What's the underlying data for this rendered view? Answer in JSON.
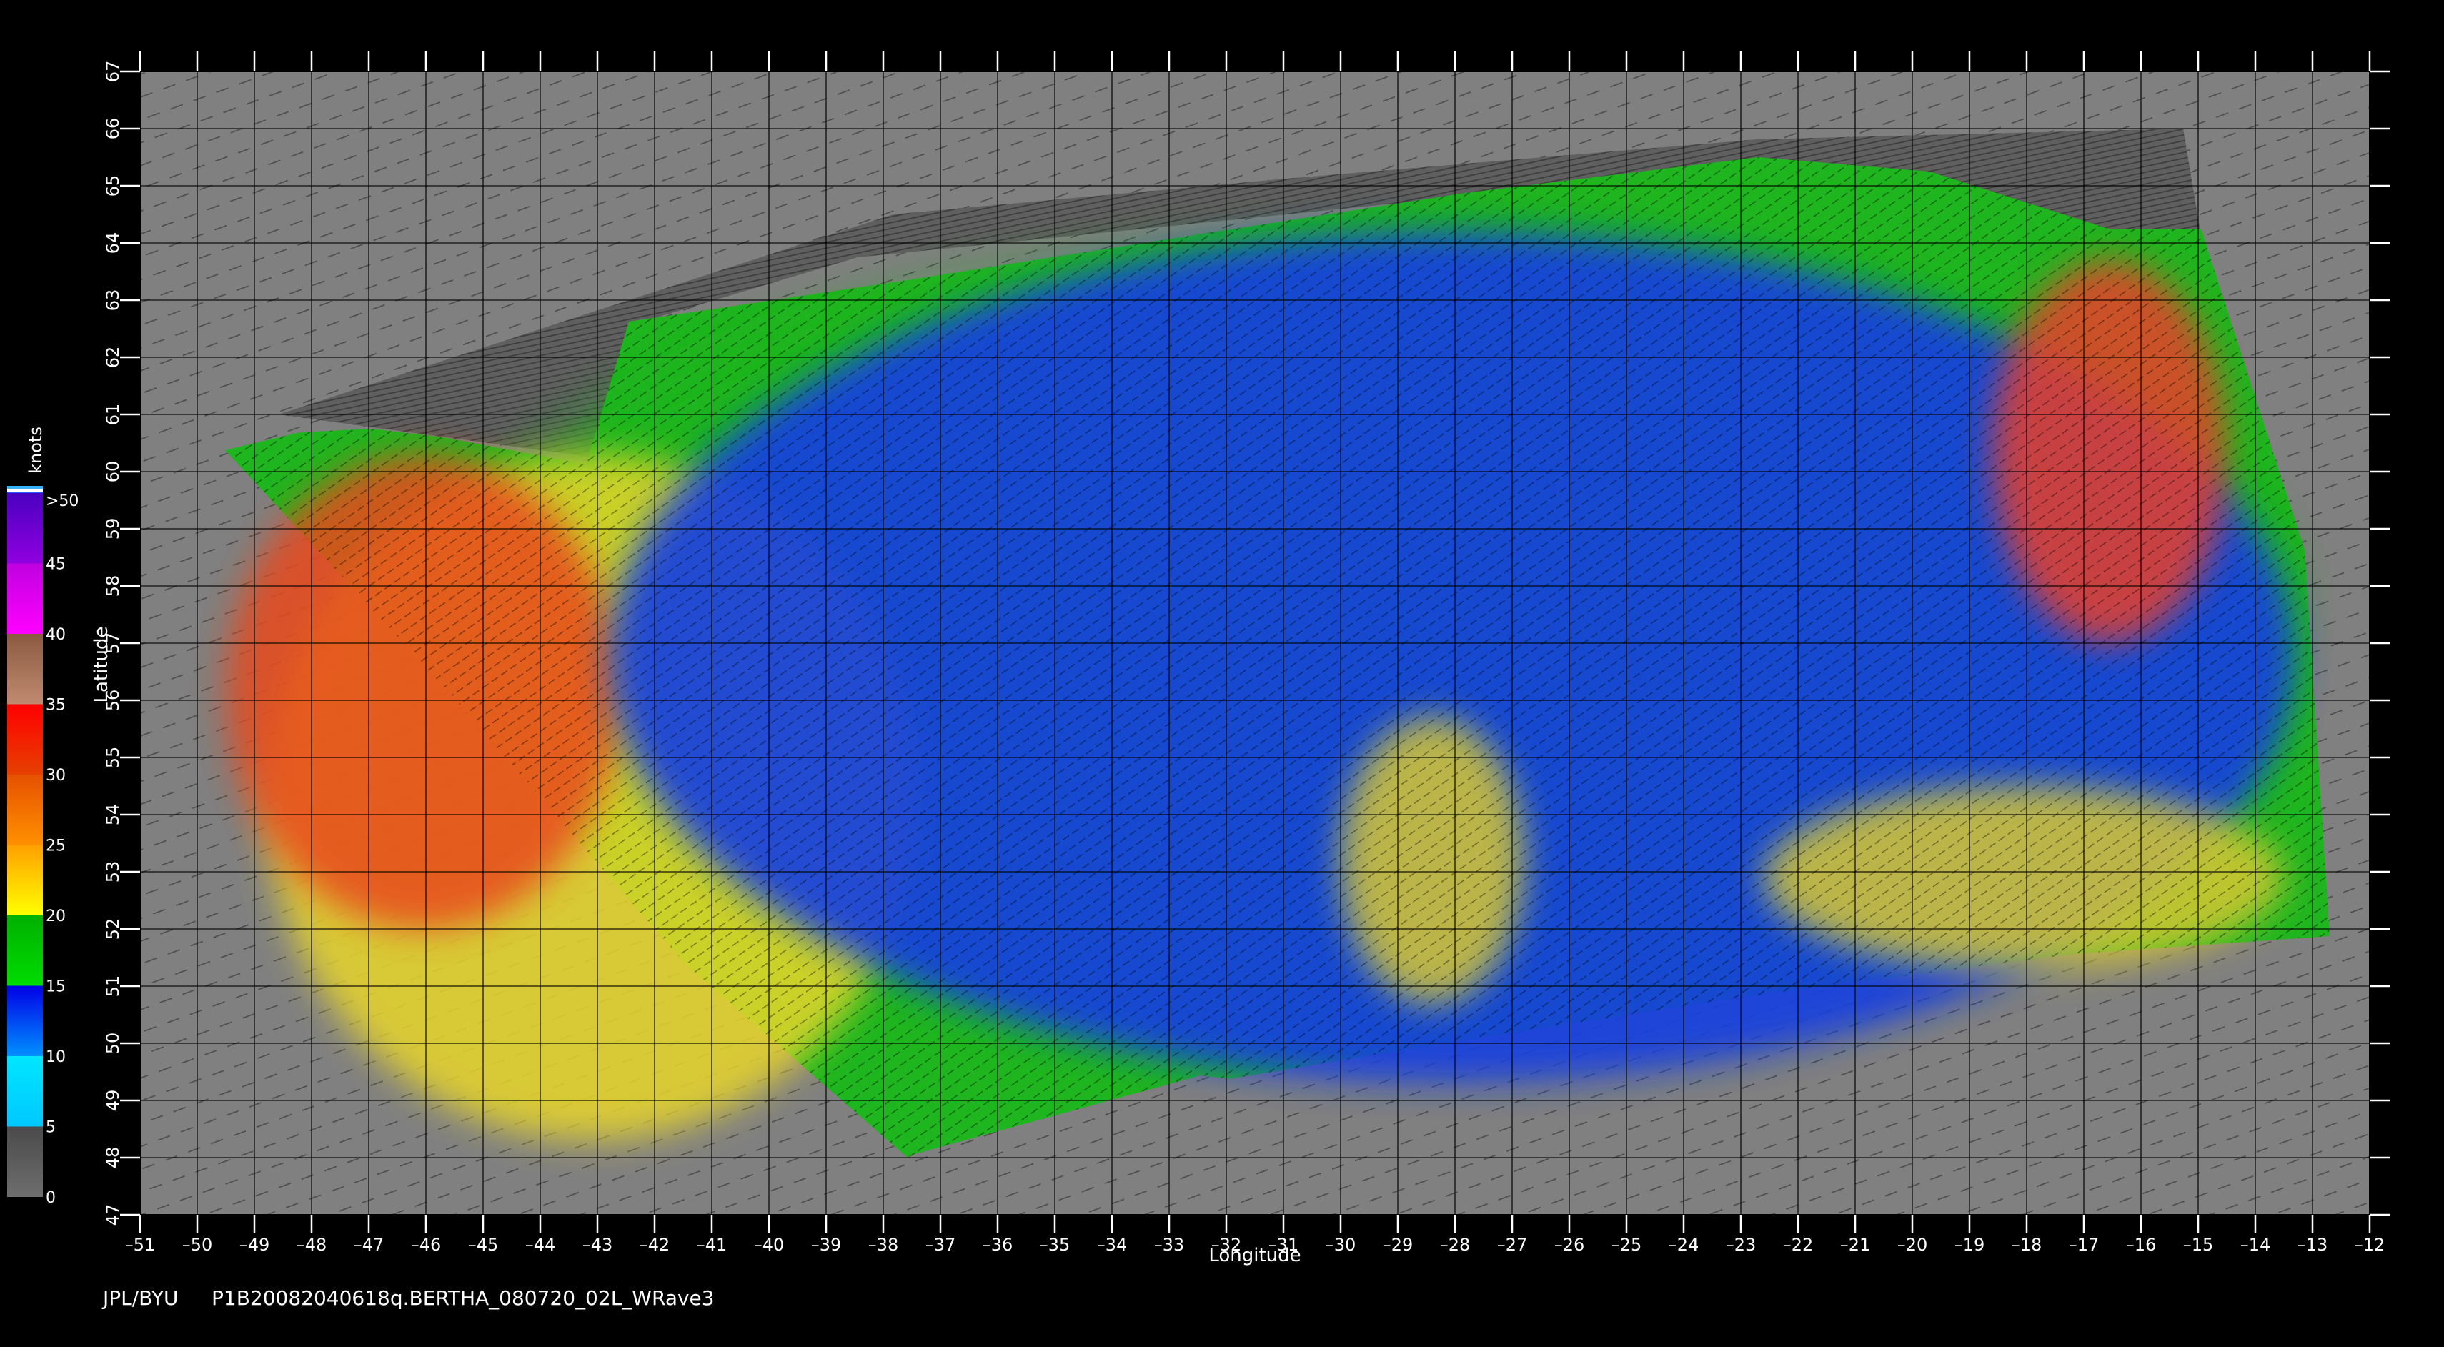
{
  "axes": {
    "x_label": "Longitude",
    "y_label": "Latitude",
    "lon_range": [
      -51,
      -12
    ],
    "lat_range": [
      47,
      67
    ],
    "lon_ticks": [
      -51,
      -50,
      -49,
      -48,
      -47,
      -46,
      -45,
      -44,
      -43,
      -42,
      -41,
      -40,
      -39,
      -38,
      -37,
      -36,
      -35,
      -34,
      -33,
      -32,
      -31,
      -30,
      -29,
      -28,
      -27,
      -26,
      -25,
      -24,
      -23,
      -22,
      -21,
      -20,
      -19,
      -18,
      -17,
      -16,
      -15,
      -14,
      -13,
      -12
    ],
    "lat_ticks": [
      47,
      48,
      49,
      50,
      51,
      52,
      53,
      54,
      55,
      56,
      57,
      58,
      59,
      60,
      61,
      62,
      63,
      64,
      65,
      66,
      67
    ],
    "grid": true
  },
  "colorbar": {
    "unit": "knots",
    "top_label": ">50",
    "labels": [
      "0",
      "5",
      "10",
      "15",
      "20",
      "25",
      "30",
      "35",
      "40",
      "45",
      ">50"
    ],
    "bands": [
      {
        "from": 0,
        "to": 5,
        "top": "#4a4a4a",
        "bottom": "#6e6e6e"
      },
      {
        "from": 5,
        "to": 10,
        "top": "#00e6ff",
        "bottom": "#00c8ff"
      },
      {
        "from": 10,
        "to": 15,
        "top": "#0000e6",
        "bottom": "#0090ff"
      },
      {
        "from": 15,
        "to": 20,
        "top": "#00b000",
        "bottom": "#00dc00"
      },
      {
        "from": 20,
        "to": 25,
        "top": "#ffa000",
        "bottom": "#ffff00"
      },
      {
        "from": 25,
        "to": 30,
        "top": "#e65000",
        "bottom": "#ff9000"
      },
      {
        "from": 30,
        "to": 35,
        "top": "#ff0000",
        "bottom": "#e64000"
      },
      {
        "from": 35,
        "to": 40,
        "top": "#8a5a40",
        "bottom": "#c08a70"
      },
      {
        "from": 40,
        "to": 45,
        "top": "#c000e0",
        "bottom": "#ff00ff"
      },
      {
        "from": 45,
        "to": 50,
        "top": "#4a00c0",
        "bottom": "#9000e0"
      }
    ],
    "top_stripes": [
      "#33b3ff",
      "#ffffff",
      "#2255ff"
    ]
  },
  "colors": {
    "background": "#000000",
    "land_fill": "#808080",
    "swath_nodata": "#6a6a6a",
    "grid": "#000000"
  },
  "wind_regions": [
    {
      "level": "green",
      "color": "#1fb51f",
      "lat": [
        51.4,
        63.8
      ],
      "lon": [
        -45.5,
        -13.5
      ]
    },
    {
      "level": "yellow",
      "color": "#e8d62a",
      "lat": [
        48.3,
        60.3
      ],
      "lon": [
        -48.8,
        -37.4
      ]
    },
    {
      "level": "orange-red",
      "color": "#e84a1e",
      "lat": [
        52.0,
        60.3
      ],
      "lon": [
        -49.5,
        -42.6
      ]
    },
    {
      "level": "blue",
      "color": "#1440e0",
      "lat": [
        49.3,
        64.2
      ],
      "lon": [
        -42.8,
        -13.3
      ]
    },
    {
      "level": "red",
      "color": "#e8402a",
      "lat": [
        57.0,
        63.7
      ],
      "lon": [
        -18.6,
        -14.5
      ]
    },
    {
      "level": "yellow",
      "color": "#d8c832",
      "lat": [
        50.7,
        55.7
      ],
      "lon": [
        -30.0,
        -26.8
      ]
    },
    {
      "level": "yellow",
      "color": "#d8c832",
      "lat": [
        51.3,
        54.5
      ],
      "lon": [
        -22.6,
        -13.5
      ]
    }
  ],
  "footer": {
    "source": "JPL/BYU",
    "product": "P1B20082040618q.BERTHA_080720_02L_WRave3"
  }
}
